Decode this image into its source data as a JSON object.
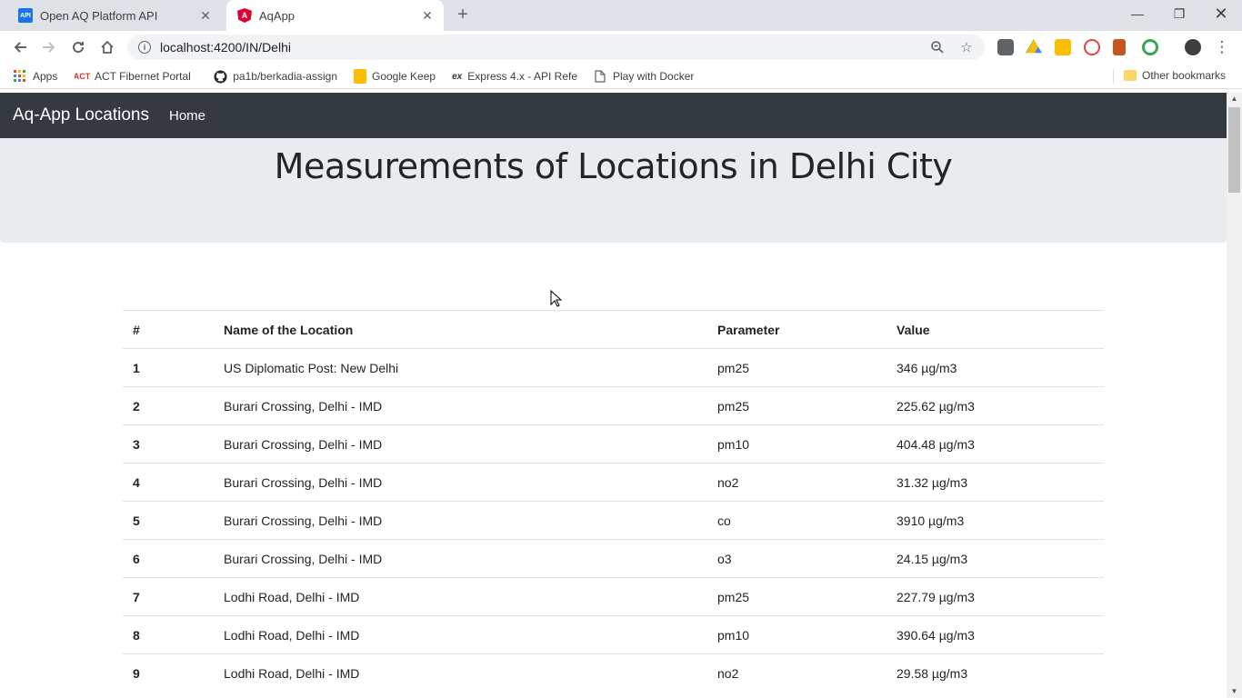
{
  "browser": {
    "tabs": [
      {
        "title": "Open AQ Platform API",
        "favicon": "API"
      },
      {
        "title": "AqApp",
        "favicon": "A"
      }
    ],
    "url": "localhost:4200/IN/Delhi",
    "bookmarks": [
      {
        "label": "Apps",
        "icon": "apps-grid-icon"
      },
      {
        "label": "ACT Fibernet Portal |",
        "icon": "act-icon"
      },
      {
        "label": "pa1b/berkadia-assign",
        "icon": "github-icon"
      },
      {
        "label": "Google Keep",
        "icon": "keep-icon"
      },
      {
        "label": "Express 4.x - API Refe",
        "icon": "express-icon"
      },
      {
        "label": "Play with Docker",
        "icon": "page-icon"
      },
      {
        "label": "Other bookmarks",
        "icon": "folder-icon"
      }
    ]
  },
  "app": {
    "brand": "Aq-App Locations",
    "nav_home": "Home",
    "heading": "Measurements of Locations in Delhi City",
    "table": {
      "headers": [
        "#",
        "Name of the Location",
        "Parameter",
        "Value"
      ],
      "rows": [
        {
          "n": "1",
          "location": "US Diplomatic Post: New Delhi",
          "parameter": "pm25",
          "value": "346 µg/m3"
        },
        {
          "n": "2",
          "location": "Burari Crossing, Delhi - IMD",
          "parameter": "pm25",
          "value": "225.62 µg/m3"
        },
        {
          "n": "3",
          "location": "Burari Crossing, Delhi - IMD",
          "parameter": "pm10",
          "value": "404.48 µg/m3"
        },
        {
          "n": "4",
          "location": "Burari Crossing, Delhi - IMD",
          "parameter": "no2",
          "value": "31.32 µg/m3"
        },
        {
          "n": "5",
          "location": "Burari Crossing, Delhi - IMD",
          "parameter": "co",
          "value": "3910 µg/m3"
        },
        {
          "n": "6",
          "location": "Burari Crossing, Delhi - IMD",
          "parameter": "o3",
          "value": "24.15 µg/m3"
        },
        {
          "n": "7",
          "location": "Lodhi Road, Delhi - IMD",
          "parameter": "pm25",
          "value": "227.79 µg/m3"
        },
        {
          "n": "8",
          "location": "Lodhi Road, Delhi - IMD",
          "parameter": "pm10",
          "value": "390.64 µg/m3"
        },
        {
          "n": "9",
          "location": "Lodhi Road, Delhi - IMD",
          "parameter": "no2",
          "value": "29.58 µg/m3"
        }
      ]
    }
  },
  "colors": {
    "navbar": "#343a40",
    "jumbotron": "#e9ecef",
    "tab_strip": "#dee1e6"
  }
}
